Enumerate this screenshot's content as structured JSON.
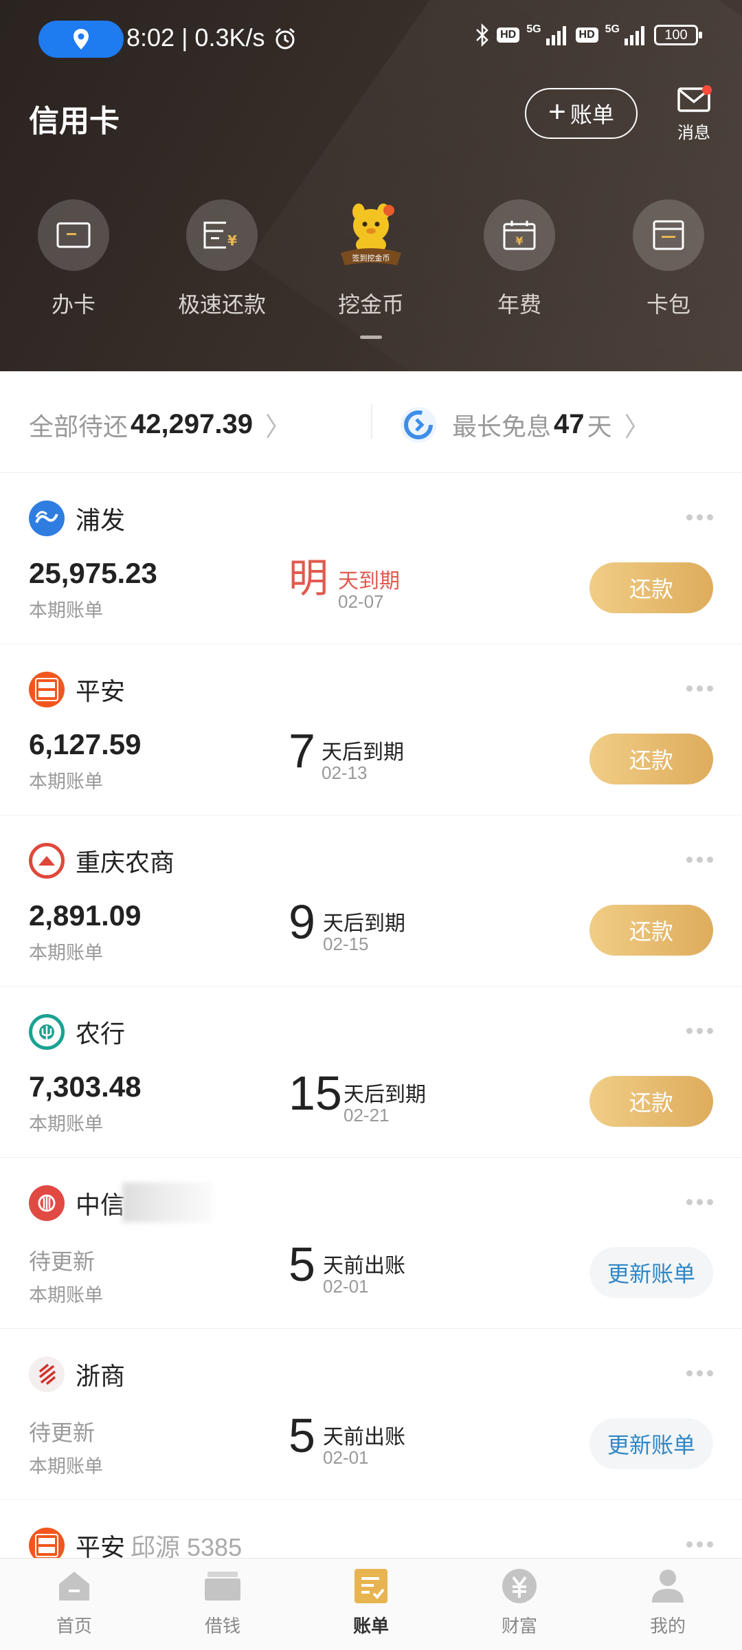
{
  "status_bar": {
    "time_speed": "8:02 | 0.3K/s",
    "hd1": "HD",
    "g1": "5G",
    "hd2": "HD",
    "g2": "5G",
    "battery": "100"
  },
  "header": {
    "title": "信用卡",
    "bill_button": "账单",
    "message_label": "消息"
  },
  "quick_actions": [
    {
      "label": "办卡",
      "icon": "card-icon"
    },
    {
      "label": "极速还款",
      "icon": "fast-repay-icon"
    },
    {
      "label": "挖金币",
      "icon": "mascot-icon",
      "badge": "签到挖金币"
    },
    {
      "label": "年费",
      "icon": "calendar-icon"
    },
    {
      "label": "卡包",
      "icon": "wallet-icon"
    }
  ],
  "summary": {
    "total_label": "全部待还",
    "total_value": "42,297.39",
    "interest_label": "最长免息",
    "interest_days": "47",
    "interest_unit": "天"
  },
  "cards": [
    {
      "bank": "浦发",
      "holder": "",
      "amount": "25,975.23",
      "amount_label": "本期账单",
      "due_big": "明",
      "due_text": "天到期",
      "due_date": "02-07",
      "action": "还款",
      "urgent": true
    },
    {
      "bank": "平安",
      "holder": "",
      "amount": "6,127.59",
      "amount_label": "本期账单",
      "due_big": "7",
      "due_text": "天后到期",
      "due_date": "02-13",
      "action": "还款"
    },
    {
      "bank": "重庆农商",
      "holder": "",
      "amount": "2,891.09",
      "amount_label": "本期账单",
      "due_big": "9",
      "due_text": "天后到期",
      "due_date": "02-15",
      "action": "还款"
    },
    {
      "bank": "农行",
      "holder": "",
      "amount": "7,303.48",
      "amount_label": "本期账单",
      "due_big": "15",
      "due_text": "天后到期",
      "due_date": "02-21",
      "action": "还款"
    },
    {
      "bank": "中信",
      "holder": "",
      "amount": "待更新",
      "amount_label": "本期账单",
      "due_big": "5",
      "due_text": "天前出账",
      "due_date": "02-01",
      "action": "更新账单"
    },
    {
      "bank": "浙商",
      "holder": "",
      "amount": "待更新",
      "amount_label": "本期账单",
      "due_big": "5",
      "due_text": "天前出账",
      "due_date": "02-01",
      "action": "更新账单"
    },
    {
      "bank": "平安",
      "holder": "邱源 5385"
    }
  ],
  "bottom_nav": [
    {
      "label": "首页"
    },
    {
      "label": "借钱"
    },
    {
      "label": "账单"
    },
    {
      "label": "财富"
    },
    {
      "label": "我的"
    }
  ],
  "colors": {
    "accent_blue": "#1e7bf0",
    "gold": "#deac5c",
    "urgent_red": "#e05a4e",
    "link_blue": "#2f86c6"
  }
}
